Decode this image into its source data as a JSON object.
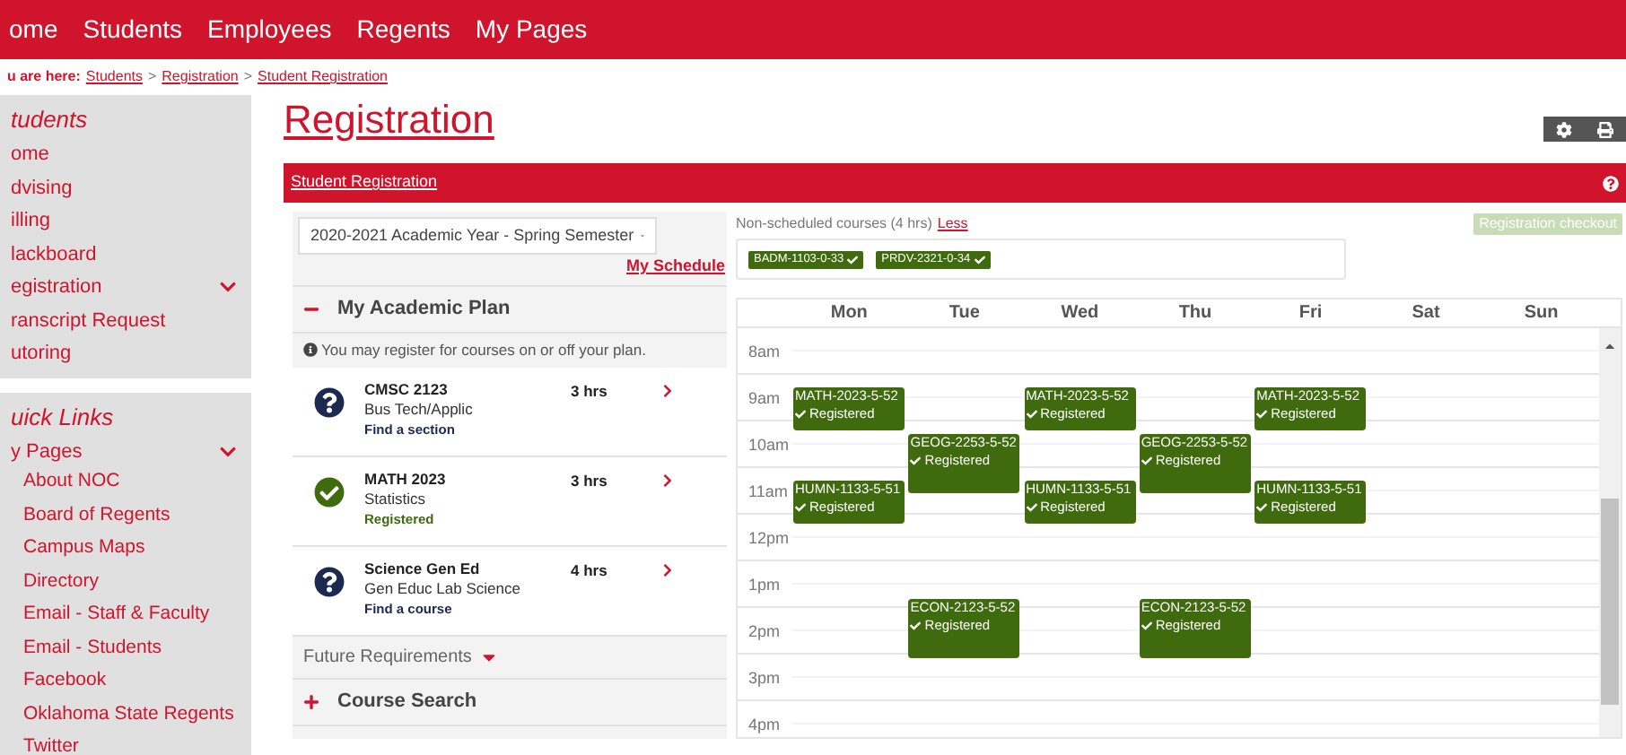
{
  "nav": [
    "ome",
    "Students",
    "Employees",
    "Regents",
    "My Pages"
  ],
  "breadcrumb": {
    "label": "u are here:",
    "links": [
      "Students",
      "Registration",
      "Student Registration"
    ],
    "separator": ">"
  },
  "sidebar": {
    "sections": [
      {
        "title": "tudents",
        "items": [
          {
            "label": "ome",
            "expanded": false
          },
          {
            "label": "dvising",
            "expanded": false
          },
          {
            "label": "illing",
            "expanded": false
          },
          {
            "label": "lackboard",
            "expanded": false
          },
          {
            "label": "egistration",
            "expanded": true
          },
          {
            "label": "ranscript Request",
            "expanded": false
          },
          {
            "label": "utoring",
            "expanded": false
          }
        ]
      },
      {
        "title": "uick Links",
        "items": [
          {
            "label": "y Pages",
            "expanded": true,
            "children": [
              "About NOC",
              "Board of Regents",
              "Campus Maps",
              "Directory",
              "Email - Staff & Faculty",
              "Email - Students",
              "Facebook",
              "Oklahoma State Regents",
              "Twitter"
            ]
          }
        ]
      }
    ]
  },
  "page_title": "Registration",
  "panel_title": "Student Registration",
  "term_select": "2020-2021 Academic Year - Spring Semester",
  "my_schedule": "My Schedule",
  "plan": {
    "title": "My Academic Plan",
    "expanded": true,
    "note": "You may register for courses on or off your plan.",
    "courses": [
      {
        "code": "CMSC 2123",
        "name": "Bus Tech/Applic",
        "hours": "3 hrs",
        "action": "Find a section",
        "registered": false
      },
      {
        "code": "MATH 2023",
        "name": "Statistics",
        "hours": "3 hrs",
        "action": "Registered",
        "registered": true
      },
      {
        "code": "Science Gen Ed",
        "name": "Gen Educ Lab Science",
        "hours": "4 hrs",
        "action": "Find a course",
        "registered": false
      }
    ]
  },
  "future_requirements": "Future Requirements",
  "course_search": {
    "title": "Course Search",
    "expanded": false
  },
  "non_scheduled": {
    "label": "Non-scheduled courses (4 hrs)",
    "toggle": "Less",
    "courses": [
      "BADM-1103-0-33",
      "PRDV-2321-0-34"
    ]
  },
  "checkout": {
    "label": "Registration checkout",
    "disabled": true
  },
  "calendar": {
    "days": [
      {
        "name": "Mon",
        "events": [
          {
            "code": "MATH-2023-5-52",
            "status": "Registered"
          },
          {
            "code": "HUMN-1133-5-51",
            "status": "Registered"
          }
        ]
      },
      {
        "name": "Tue",
        "events": [
          {
            "code": "GEOG-2253-5-52",
            "status": "Registered"
          },
          {
            "code": "ECON-2123-5-52",
            "status": "Registered"
          }
        ]
      },
      {
        "name": "Wed",
        "events": [
          {
            "code": "MATH-2023-5-52",
            "status": "Registered"
          },
          {
            "code": "HUMN-1133-5-51",
            "status": "Registered"
          }
        ]
      },
      {
        "name": "Thu",
        "events": [
          {
            "code": "GEOG-2253-5-52",
            "status": "Registered"
          },
          {
            "code": "ECON-2123-5-52",
            "status": "Registered"
          }
        ]
      },
      {
        "name": "Fri",
        "events": [
          {
            "code": "MATH-2023-5-52",
            "status": "Registered"
          },
          {
            "code": "HUMN-1133-5-51",
            "status": "Registered"
          }
        ]
      },
      {
        "name": "Sat"
      },
      {
        "name": "Sun"
      }
    ],
    "hours": [
      "8am",
      "9am",
      "10am",
      "11am",
      "12pm",
      "1pm",
      "2pm",
      "3pm",
      "4pm"
    ]
  }
}
